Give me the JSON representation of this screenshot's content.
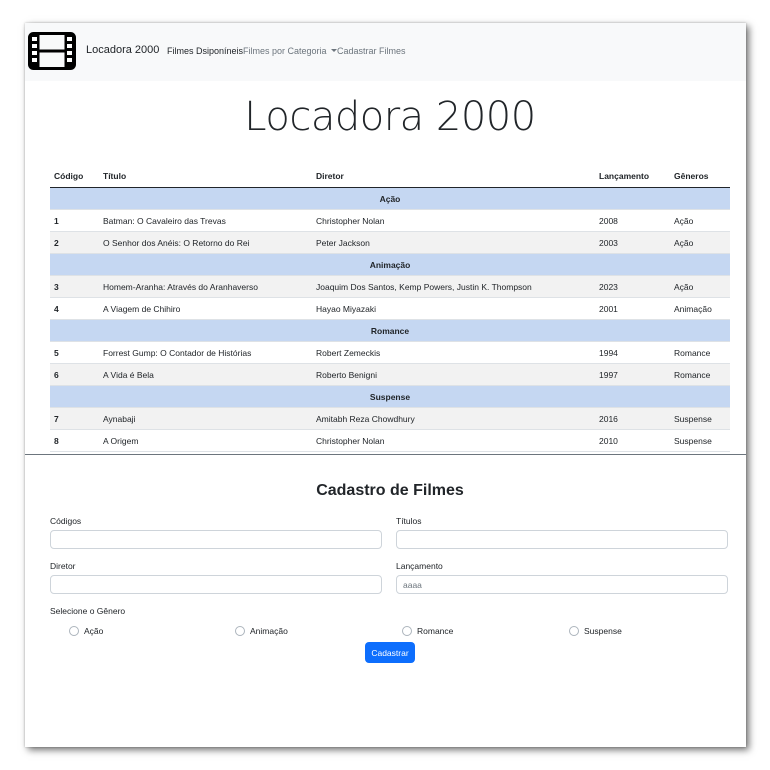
{
  "navbar": {
    "brand": "Locadora 2000",
    "links": [
      "Filmes Dsiponíneis",
      "Filmes por Categoria",
      "Cadastrar Filmes"
    ]
  },
  "page_title": "Locadora 2000",
  "table": {
    "headers": [
      "Código",
      "Título",
      "Diretor",
      "Lançamento",
      "Gêneros"
    ],
    "groups": [
      {
        "name": "Ação",
        "rows": [
          [
            "1",
            "Batman: O Cavaleiro das Trevas",
            "Christopher Nolan",
            "2008",
            "Ação"
          ],
          [
            "2",
            "O Senhor dos Anéis: O Retorno do Rei",
            "Peter Jackson",
            "2003",
            "Ação"
          ]
        ]
      },
      {
        "name": "Animação",
        "rows": [
          [
            "3",
            "Homem-Aranha: Através do Aranhaverso",
            "Joaquim Dos Santos, Kemp Powers, Justin K. Thompson",
            "2023",
            "Ação"
          ],
          [
            "4",
            "A Viagem de Chihiro",
            "Hayao Miyazaki",
            "2001",
            "Animação"
          ]
        ]
      },
      {
        "name": "Romance",
        "rows": [
          [
            "5",
            "Forrest Gump: O Contador de Histórias",
            "Robert Zemeckis",
            "1994",
            "Romance"
          ],
          [
            "6",
            "A Vida é Bela",
            "Roberto Benigni",
            "1997",
            "Romance"
          ]
        ]
      },
      {
        "name": "Suspense",
        "rows": [
          [
            "7",
            "Aynabaji",
            "Amitabh Reza Chowdhury",
            "2016",
            "Suspense"
          ],
          [
            "8",
            "A Origem",
            "Christopher Nolan",
            "2010",
            "Suspense"
          ]
        ]
      }
    ]
  },
  "form": {
    "title": "Cadastro de Filmes",
    "codigo_label": "Códigos",
    "codigo_value": "",
    "titulo_label": "Títulos",
    "titulo_value": "",
    "diretor_label": "Diretor",
    "diretor_value": "",
    "lancamento_label": "Lançamento",
    "lancamento_placeholder": "aaaa",
    "genero_label": "Selecione o Gênero",
    "generos": [
      "Ação",
      "Animação",
      "Romance",
      "Suspense"
    ],
    "submit": "Cadastrar"
  },
  "colors": {
    "primary": "#0d6efd",
    "group_row": "#c5d7f2",
    "navbar_bg": "#f8f9fa"
  }
}
